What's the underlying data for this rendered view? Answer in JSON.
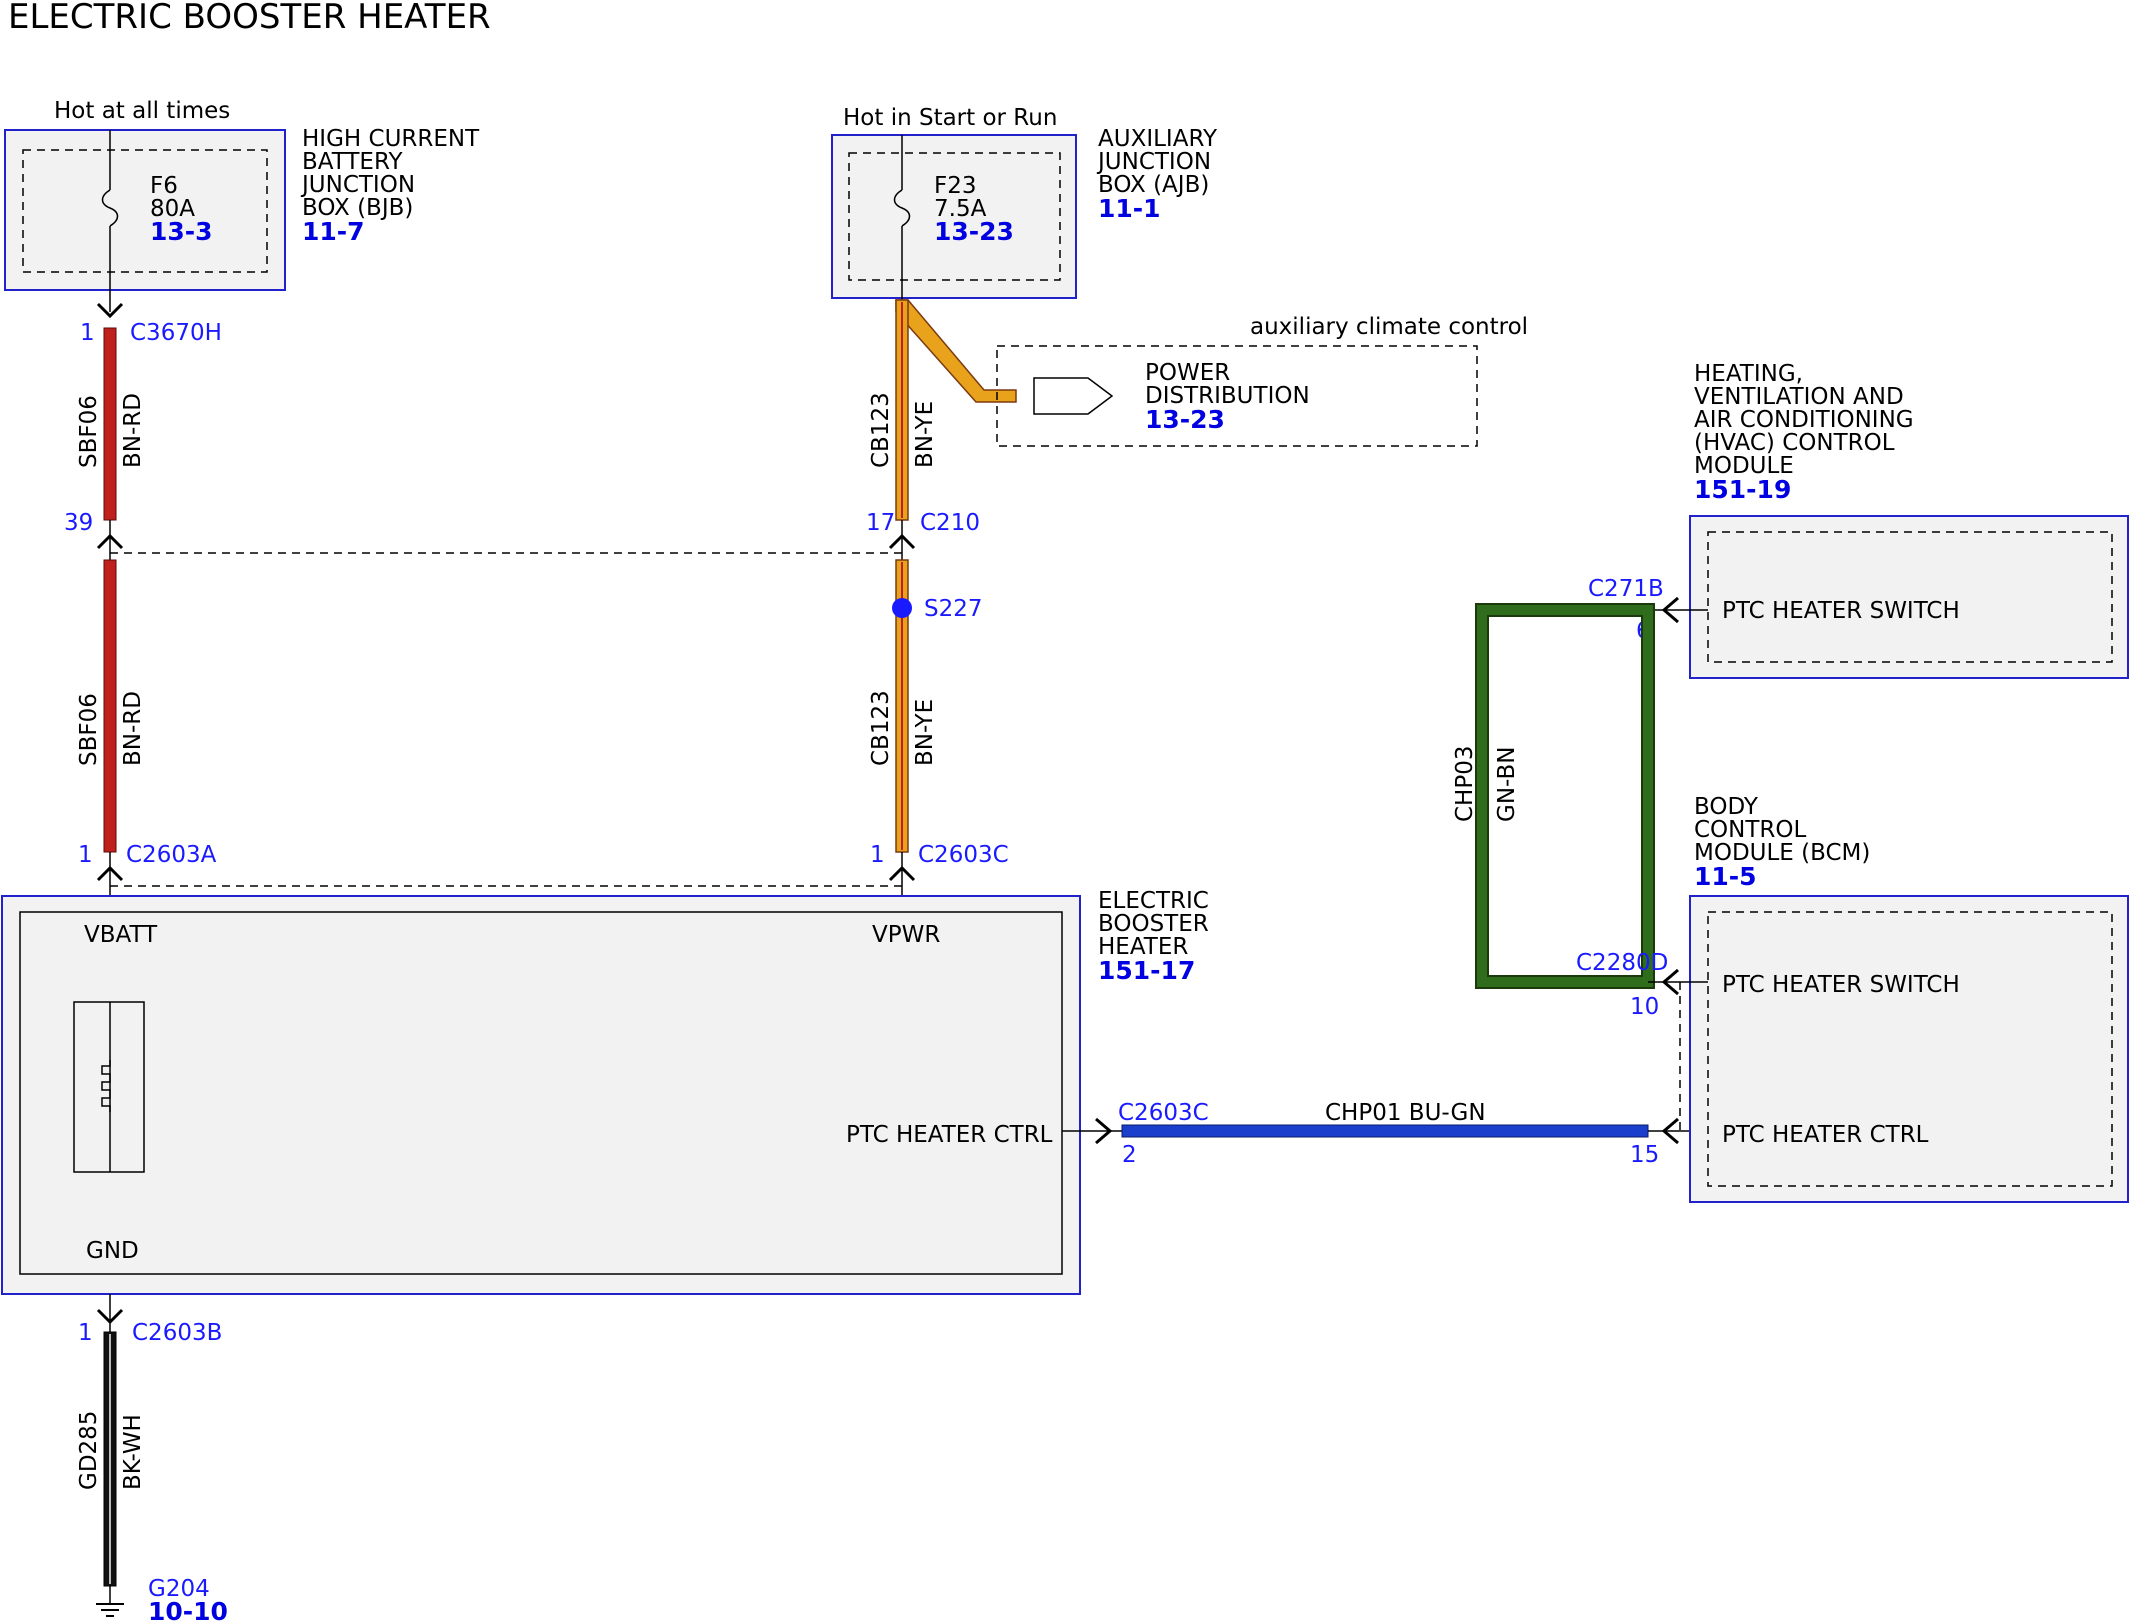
{
  "title": "ELECTRIC BOOSTER HEATER",
  "bjb": {
    "hot_label": "Hot at all times",
    "name_lines": [
      "HIGH CURRENT",
      "BATTERY",
      "JUNCTION",
      "BOX (BJB)"
    ],
    "ref": "11-7",
    "fuse": {
      "id": "F6",
      "rating": "80A",
      "ref": "13-3"
    }
  },
  "ajb": {
    "hot_label": "Hot in Start or Run",
    "name_lines": [
      "AUXILIARY",
      "JUNCTION",
      "BOX (AJB)"
    ],
    "ref": "11-1",
    "fuse": {
      "id": "F23",
      "rating": "7.5A",
      "ref": "13-23"
    }
  },
  "aux_climate": {
    "label": "auxiliary climate control",
    "name_lines": [
      "POWER",
      "DISTRIBUTION"
    ],
    "ref": "13-23"
  },
  "hvac": {
    "name_lines": [
      "HEATING,",
      "VENTILATION AND",
      "AIR CONDITIONING",
      "(HVAC) CONTROL",
      "MODULE"
    ],
    "ref": "151-19",
    "pin_label": "PTC HEATER SWITCH",
    "connector": "C271B",
    "pin": "6"
  },
  "bcm": {
    "name_lines": [
      "BODY",
      "CONTROL",
      "MODULE (BCM)"
    ],
    "ref": "11-5",
    "pins": [
      {
        "label": "PTC HEATER SWITCH",
        "pin": "10"
      },
      {
        "label": "PTC HEATER CTRL",
        "pin": "15"
      }
    ],
    "connector": "C2280D"
  },
  "heater": {
    "name_lines": [
      "ELECTRIC",
      "BOOSTER",
      "HEATER"
    ],
    "ref": "151-17",
    "vbatt": "VBATT",
    "vpwr": "VPWR",
    "ctrl": "PTC HEATER CTRL",
    "gnd": "GND"
  },
  "connectors": {
    "c3670h": {
      "name": "C3670H",
      "pin": "1"
    },
    "c210": {
      "name": "C210",
      "pin_left": "39",
      "pin_right": "17"
    },
    "s227": "S227",
    "c2603a": {
      "name": "C2603A",
      "pin": "1"
    },
    "c2603c_top": {
      "name": "C2603C",
      "pin": "1"
    },
    "c2603c_ctrl": {
      "name": "C2603C",
      "pin": "2"
    },
    "c2603b": {
      "name": "C2603B",
      "pin": "1"
    }
  },
  "wires": {
    "sbf06_upper": {
      "circuit": "SBF06",
      "color": "BN-RD"
    },
    "sbf06_lower": {
      "circuit": "SBF06",
      "color": "BN-RD"
    },
    "cb123_upper": {
      "circuit": "CB123",
      "color": "BN-YE"
    },
    "cb123_lower": {
      "circuit": "CB123",
      "color": "BN-YE"
    },
    "chp03": {
      "circuit": "CHP03",
      "color": "GN-BN"
    },
    "chp01": {
      "label": "CHP01  BU-GN"
    },
    "gd285": {
      "circuit": "GD285",
      "color": "BK-WH"
    }
  },
  "ground": {
    "name": "G204",
    "ref": "10-10"
  },
  "colors": {
    "module_border": "#2222cc",
    "module_fill": "#f2f2f2",
    "wire_bn_rd": "#c0201c",
    "wire_bn_ye": "#e8a21c",
    "wire_bn_ye_edge": "#7a3a10",
    "wire_gn_bn": "#2f6d1c",
    "wire_bu_gn": "#1a3fcc",
    "wire_bk_wh": "#111111",
    "label_blue": "#1a1aff",
    "ref_blue": "#0000e0"
  }
}
